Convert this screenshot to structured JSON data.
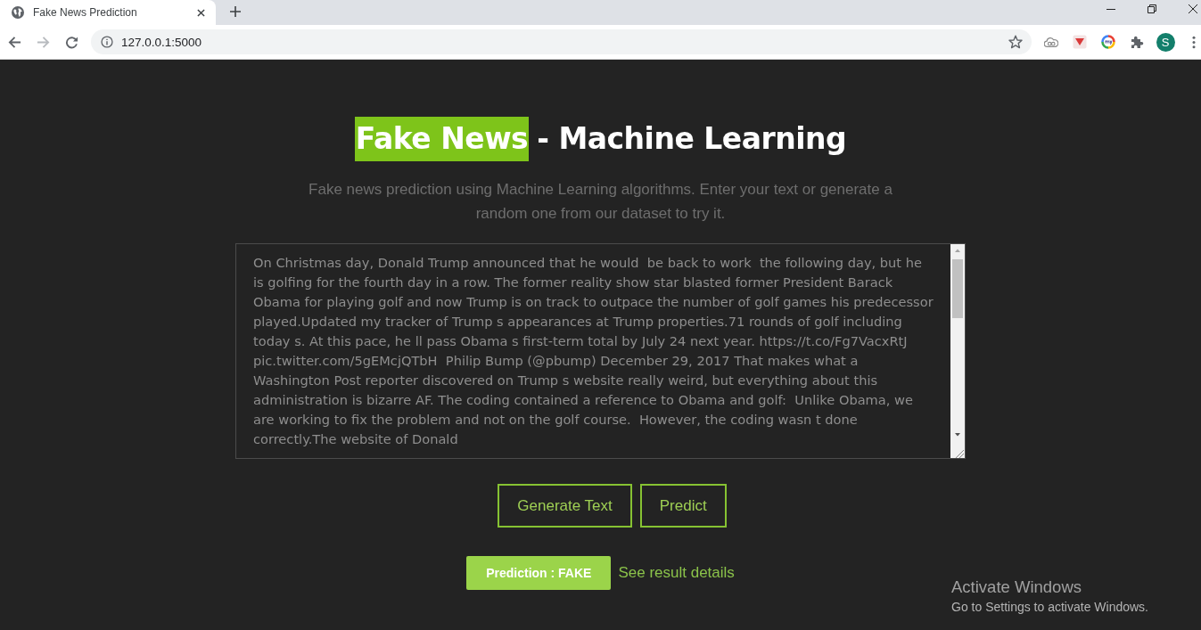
{
  "browser": {
    "tabs": [
      {
        "title": "Fake News Prediction",
        "selected": true
      }
    ],
    "nav_buttons": [
      {
        "kind": "back",
        "disabled": false
      },
      {
        "kind": "forward",
        "disabled": true
      },
      {
        "kind": "reload",
        "disabled": false
      }
    ],
    "url": "127.0.0.1:5000",
    "profile_initial": "S"
  },
  "heading": {
    "highlight": "Fake News",
    "rest": "- Machine Learning"
  },
  "subtitle": "Fake news prediction using Machine Learning algorithms. Enter your text or generate a random one from our dataset to try it.",
  "news_input": {
    "value": "On Christmas day, Donald Trump announced that he would  be back to work  the following day, but he is golfing for the fourth day in a row. The former reality show star blasted former President Barack Obama for playing golf and now Trump is on track to outpace the number of golf games his predecessor played.Updated my tracker of Trump s appearances at Trump properties.71 rounds of golf including today s. At this pace, he ll pass Obama s first-term total by July 24 next year. https://t.co/Fg7VacxRtJ pic.twitter.com/5gEMcjQTbH  Philip Bump (@pbump) December 29, 2017 That makes what a Washington Post reporter discovered on Trump s website really weird, but everything about this administration is bizarre AF. The coding contained a reference to Obama and golf:  Unlike Obama, we are working to fix the problem and not on the golf course.  However, the coding wasn t done correctly.The website of Donald"
  },
  "buttons": [
    {
      "label": "Generate Text"
    },
    {
      "label": "Predict"
    }
  ],
  "result": {
    "prediction": "Prediction : FAKE",
    "details_link": "See result details"
  },
  "os_notice": {
    "title": "Activate Windows",
    "hint": "Go to Settings to activate Windows."
  }
}
